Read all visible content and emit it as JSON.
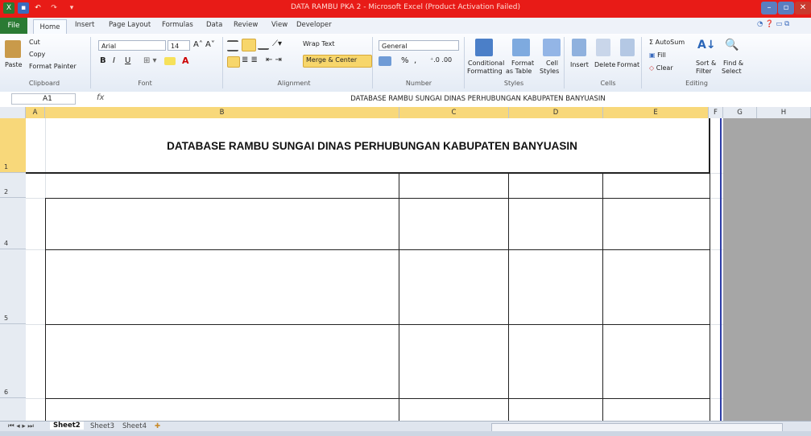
{
  "window": {
    "title": "DATA RAMBU PKA 2 - Microsoft Excel (Product Activation Failed)"
  },
  "tabs": [
    "File",
    "Home",
    "Insert",
    "Page Layout",
    "Formulas",
    "Data",
    "Review",
    "View",
    "Developer"
  ],
  "clipboard": {
    "paste": "Paste",
    "cut": "Cut",
    "copy": "Copy",
    "format_painter": "Format Painter",
    "label": "Clipboard"
  },
  "font": {
    "name": "Arial",
    "size": "14",
    "bold": "B",
    "italic": "I",
    "underline": "U",
    "label": "Font"
  },
  "alignment": {
    "wrap": "Wrap Text",
    "merge": "Merge & Center",
    "label": "Alignment"
  },
  "number": {
    "format": "General",
    "percent": "%",
    "comma": ",",
    "label": "Number"
  },
  "styles": {
    "conditional": "Conditional",
    "conditional2": "Formatting",
    "format": "Format",
    "format2": "as Table",
    "cell": "Cell",
    "cell2": "Styles",
    "label": "Styles"
  },
  "cells": {
    "insert": "Insert",
    "delete": "Delete",
    "format": "Format",
    "label": "Cells"
  },
  "editing": {
    "autosum": "AutoSum",
    "fill": "Fill",
    "clear": "Clear",
    "sort": "Sort &",
    "sort2": "Filter",
    "find": "Find &",
    "find2": "Select",
    "label": "Editing"
  },
  "formula_bar": {
    "name_box": "A1",
    "fx": "fx",
    "content": "DATABASE RAMBU SUNGAI DINAS PERHUBUNGAN KABUPATEN BANYUASIN"
  },
  "columns": [
    "A",
    "B",
    "C",
    "D",
    "E",
    "F",
    "G",
    "H"
  ],
  "rows": [
    "1",
    "2",
    "4",
    "5",
    "6"
  ],
  "sheet_title": "DATABASE RAMBU SUNGAI DINAS PERHUBUNGAN KABUPATEN BANYUASIN",
  "sheet_tabs": [
    "Sheet2",
    "Sheet3",
    "Sheet4"
  ],
  "colors": {
    "title_bar": "#e81b17",
    "file_tab": "#2a7a33",
    "header_sel": "#f8d87a",
    "outside_print": "#a6a6a6"
  }
}
